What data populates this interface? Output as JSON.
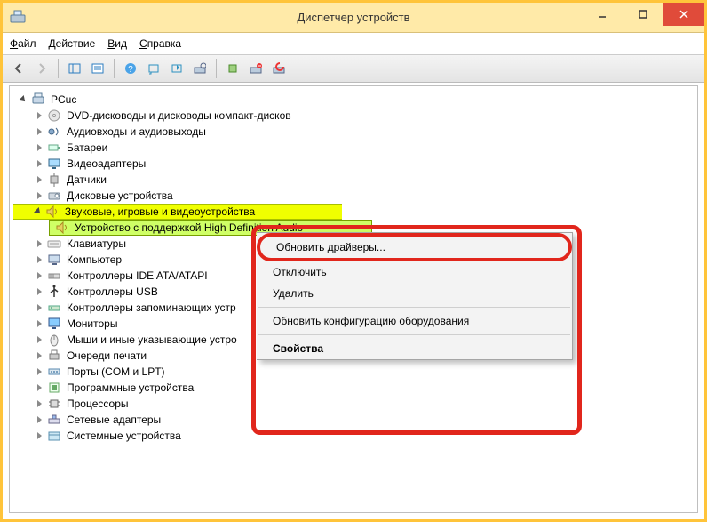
{
  "title": "Диспетчер устройств",
  "menu": {
    "file": "Файл",
    "action": "Действие",
    "view": "Вид",
    "help": "Справка"
  },
  "root": "PCuc",
  "categories": [
    {
      "label": "DVD-дисководы и дисководы компакт-дисков"
    },
    {
      "label": "Аудиовходы и аудиовыходы"
    },
    {
      "label": "Батареи"
    },
    {
      "label": "Видеоадаптеры"
    },
    {
      "label": "Датчики"
    },
    {
      "label": "Дисковые устройства"
    },
    {
      "label": "Звуковые, игровые и видеоустройства",
      "expanded": true,
      "children": [
        {
          "label": "Устройство с поддержкой High Definition Audio",
          "selected": true
        }
      ]
    },
    {
      "label": "Клавиатуры"
    },
    {
      "label": "Компьютер"
    },
    {
      "label": "Контроллеры IDE ATA/ATAPI"
    },
    {
      "label": "Контроллеры USB"
    },
    {
      "label": "Контроллеры запоминающих устр"
    },
    {
      "label": "Мониторы"
    },
    {
      "label": "Мыши и иные указывающие устро"
    },
    {
      "label": "Очереди печати"
    },
    {
      "label": "Порты (COM и LPT)"
    },
    {
      "label": "Программные устройства"
    },
    {
      "label": "Процессоры"
    },
    {
      "label": "Сетевые адаптеры"
    },
    {
      "label": "Системные устройства"
    }
  ],
  "context_menu": {
    "update": "Обновить драйверы...",
    "disable": "Отключить",
    "delete": "Удалить",
    "scan": "Обновить конфигурацию оборудования",
    "properties": "Свойства"
  }
}
